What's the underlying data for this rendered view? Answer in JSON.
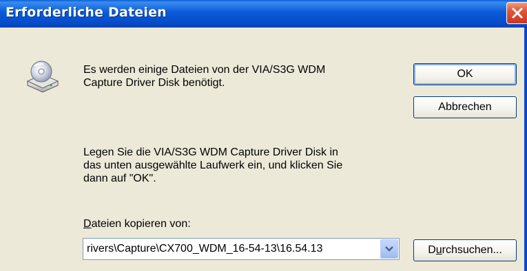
{
  "window": {
    "title": "Erforderliche Dateien"
  },
  "message": {
    "line1": "Es werden einige Dateien von der VIA/S3G WDM",
    "line2": "Capture Driver Disk benötigt.",
    "insert1": "Legen Sie die VIA/S3G WDM Capture Driver Disk in",
    "insert2": "das unten ausgewählte Laufwerk ein, und klicken Sie",
    "insert3": "dann auf \"OK\"."
  },
  "buttons": {
    "ok": "OK",
    "cancel": "Abbrechen",
    "browse_prefix": "D",
    "browse_accel": "u",
    "browse_rest": "rchsuchen..."
  },
  "copy_from": {
    "label_accel": "D",
    "label_rest": "ateien kopieren von:",
    "value": "rivers\\Capture\\CX700_WDM_16-54-13\\16.54.13"
  },
  "icons": {
    "disk": "cd-drive-icon",
    "close": "close-icon",
    "dropdown": "chevron-down-icon"
  },
  "colors": {
    "titlebar": "#0A5FD8",
    "dialog_bg": "#ECE9D8",
    "close": "#E2543A"
  }
}
